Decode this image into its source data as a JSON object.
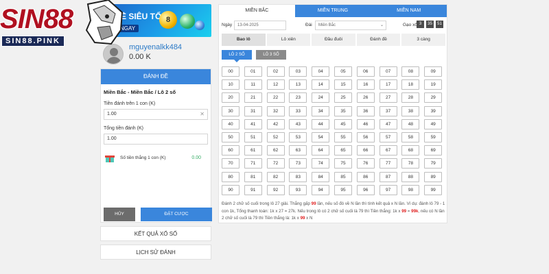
{
  "logo": {
    "main": "SIN88",
    "sub": "SIN88.PINK"
  },
  "banner": {
    "title": "Ề SIÊU TỐC",
    "sub": "NGAY",
    "ball_number": "8"
  },
  "user": {
    "name": "mguyenalkk484",
    "balance": "0.00 K"
  },
  "bet_panel": {
    "header": "ĐÁNH ĐỀ",
    "title": "Miền Bắc - Miền Bắc / Lô 2 số",
    "amount_label": "Tiền đánh trên 1 con (K)",
    "amount_value": "1.00",
    "total_label": "Tổng tiền đánh (K)",
    "total_value": "1.00",
    "win_label": "Số tiền thắng 1 con (K)",
    "win_value": "0.00",
    "cancel_label": "HỦY",
    "submit_label": "ĐẶT CƯỢC"
  },
  "side_links": [
    {
      "label": "KẾT QUẢ XỔ SỐ"
    },
    {
      "label": "LỊCH SỬ ĐÁNH"
    }
  ],
  "region_tabs": [
    {
      "label": "MIỀN BẮC",
      "active": true
    },
    {
      "label": "MIỀN TRUNG",
      "active": false
    },
    {
      "label": "MIỀN NAM",
      "active": false
    }
  ],
  "filters": {
    "date_label": "Ngày",
    "date_value": "13-04-2025",
    "station_label": "Đài",
    "station_value": "Miền Bắc",
    "draw_label": "Gạo xổ",
    "draw_numbers": [
      "3",
      "35",
      "51"
    ]
  },
  "bet_types": [
    {
      "label": "Bao lô",
      "active": true
    },
    {
      "label": "Lô xiên",
      "active": false
    },
    {
      "label": "Đầu đuôi",
      "active": false
    },
    {
      "label": "Đánh đề",
      "active": false
    },
    {
      "label": "3 càng",
      "active": false
    }
  ],
  "sub_tabs": [
    {
      "label": "LÔ 2 SỐ",
      "active": true
    },
    {
      "label": "LÔ 3 SỐ",
      "active": false
    }
  ],
  "numbers": [
    "00",
    "01",
    "02",
    "03",
    "04",
    "05",
    "06",
    "07",
    "08",
    "09",
    "10",
    "11",
    "12",
    "13",
    "14",
    "15",
    "16",
    "17",
    "18",
    "19",
    "20",
    "21",
    "22",
    "23",
    "24",
    "25",
    "26",
    "27",
    "28",
    "29",
    "30",
    "31",
    "32",
    "33",
    "34",
    "35",
    "36",
    "37",
    "38",
    "39",
    "40",
    "41",
    "42",
    "43",
    "44",
    "45",
    "46",
    "47",
    "48",
    "49",
    "50",
    "51",
    "52",
    "53",
    "54",
    "55",
    "56",
    "57",
    "58",
    "59",
    "60",
    "61",
    "62",
    "63",
    "64",
    "65",
    "66",
    "67",
    "68",
    "69",
    "70",
    "71",
    "72",
    "73",
    "74",
    "75",
    "76",
    "77",
    "78",
    "79",
    "80",
    "81",
    "82",
    "83",
    "84",
    "85",
    "86",
    "87",
    "88",
    "89",
    "90",
    "91",
    "92",
    "93",
    "94",
    "95",
    "96",
    "97",
    "98",
    "99"
  ],
  "note": {
    "part1": "Đánh 2 chữ số cuối trong lô 27 giải. Thắng gấp ",
    "highlight1": "99",
    "part2": " lần, nếu số đó về N lần thì tính kết quả x N lần. Ví dụ: đánh lô 79 - 1 con 1k, Tổng thanh toán: 1k x 27 = 27k. Nếu trong lô có 2 chữ số cuối là 79 thì Tiền thắng: 1k x ",
    "highlight2": "99",
    "part3": " = ",
    "highlight3": "99k",
    "part4": ", nếu có N lần 2 chữ số cuối là 79 thì Tiền thắng là: 1k x ",
    "highlight4": "99",
    "part5": " x N"
  },
  "colors": {
    "primary": "#3a86dc",
    "brand_red": "#b01020",
    "brand_navy": "#1b2a57"
  }
}
